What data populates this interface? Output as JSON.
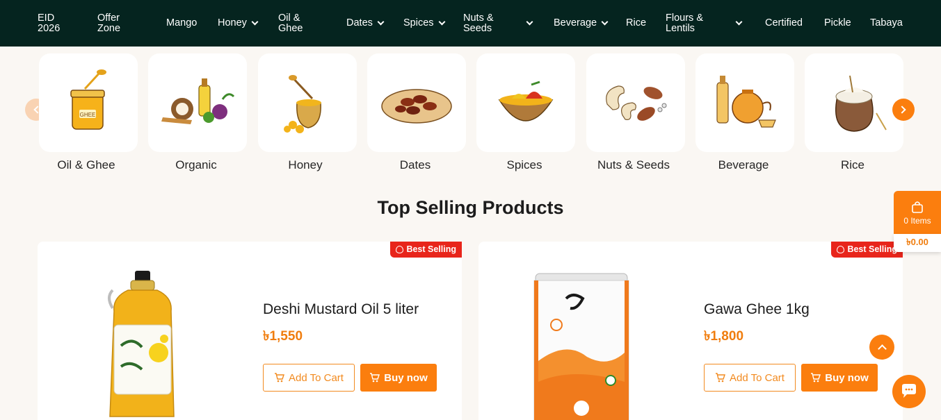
{
  "nav": {
    "items": [
      {
        "label": "EID 2026",
        "dropdown": false
      },
      {
        "label": "Offer Zone",
        "dropdown": false
      },
      {
        "label": "Mango",
        "dropdown": false
      },
      {
        "label": "Honey",
        "dropdown": true
      },
      {
        "label": "Oil & Ghee",
        "dropdown": false
      },
      {
        "label": "Dates",
        "dropdown": true
      },
      {
        "label": "Spices",
        "dropdown": true
      },
      {
        "label": "Nuts & Seeds",
        "dropdown": true
      },
      {
        "label": "Beverage",
        "dropdown": true
      },
      {
        "label": "Rice",
        "dropdown": false
      },
      {
        "label": "Flours & Lentils",
        "dropdown": true
      },
      {
        "label": "Certified",
        "dropdown": false
      },
      {
        "label": "Pickle",
        "dropdown": false
      },
      {
        "label": "Tabaya",
        "dropdown": false
      }
    ]
  },
  "categories": [
    {
      "label": "Oil & Ghee",
      "icon": "ghee-jar-icon"
    },
    {
      "label": "Organic",
      "icon": "organic-produce-icon"
    },
    {
      "label": "Honey",
      "icon": "honey-pot-icon"
    },
    {
      "label": "Dates",
      "icon": "dates-bowl-icon"
    },
    {
      "label": "Spices",
      "icon": "spices-bowl-icon"
    },
    {
      "label": "Nuts & Seeds",
      "icon": "nuts-icon"
    },
    {
      "label": "Beverage",
      "icon": "beverage-icon"
    },
    {
      "label": "Rice",
      "icon": "rice-sack-icon"
    }
  ],
  "section": {
    "title": "Top Selling Products"
  },
  "products": [
    {
      "badge": "Best Selling",
      "name": "Deshi Mustard Oil 5 liter",
      "price": "৳1,550",
      "add_to_cart": "Add To Cart",
      "buy_now": "Buy now",
      "image": "mustard-oil-bottle"
    },
    {
      "badge": "Best Selling",
      "name": "Gawa Ghee 1kg",
      "price": "৳1,800",
      "add_to_cart": "Add To Cart",
      "buy_now": "Buy now",
      "image": "ghee-tin"
    }
  ],
  "cart": {
    "items": "0 Items",
    "total": "৳0.00"
  },
  "colors": {
    "nav_bg": "#05241f",
    "accent": "#fb7e0e",
    "badge": "#e8251b",
    "page_bg": "#faf7f3"
  }
}
